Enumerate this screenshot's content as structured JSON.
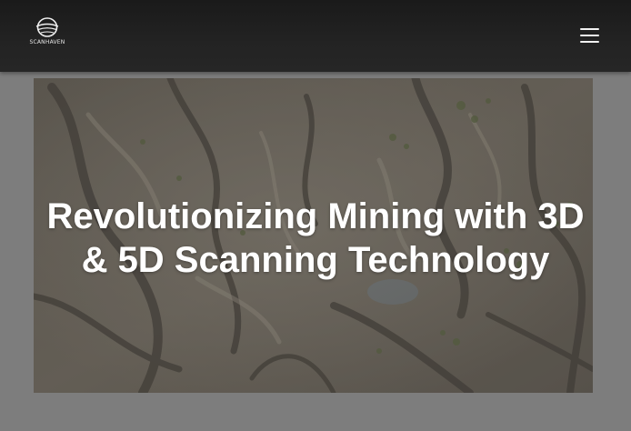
{
  "header": {
    "logo_text": "SCANHAVEN",
    "menu_icon": "hamburger-menu-icon"
  },
  "hero": {
    "title_line_1": "Revolutionizing Mining with 3D",
    "title_line_2": "& 5D Scanning Technology",
    "image": "aerial-desert-terrain-image"
  },
  "colors": {
    "navbar": "#1f1f1f",
    "page_background": "#7d7d7d",
    "title_text": "#ffffff"
  }
}
